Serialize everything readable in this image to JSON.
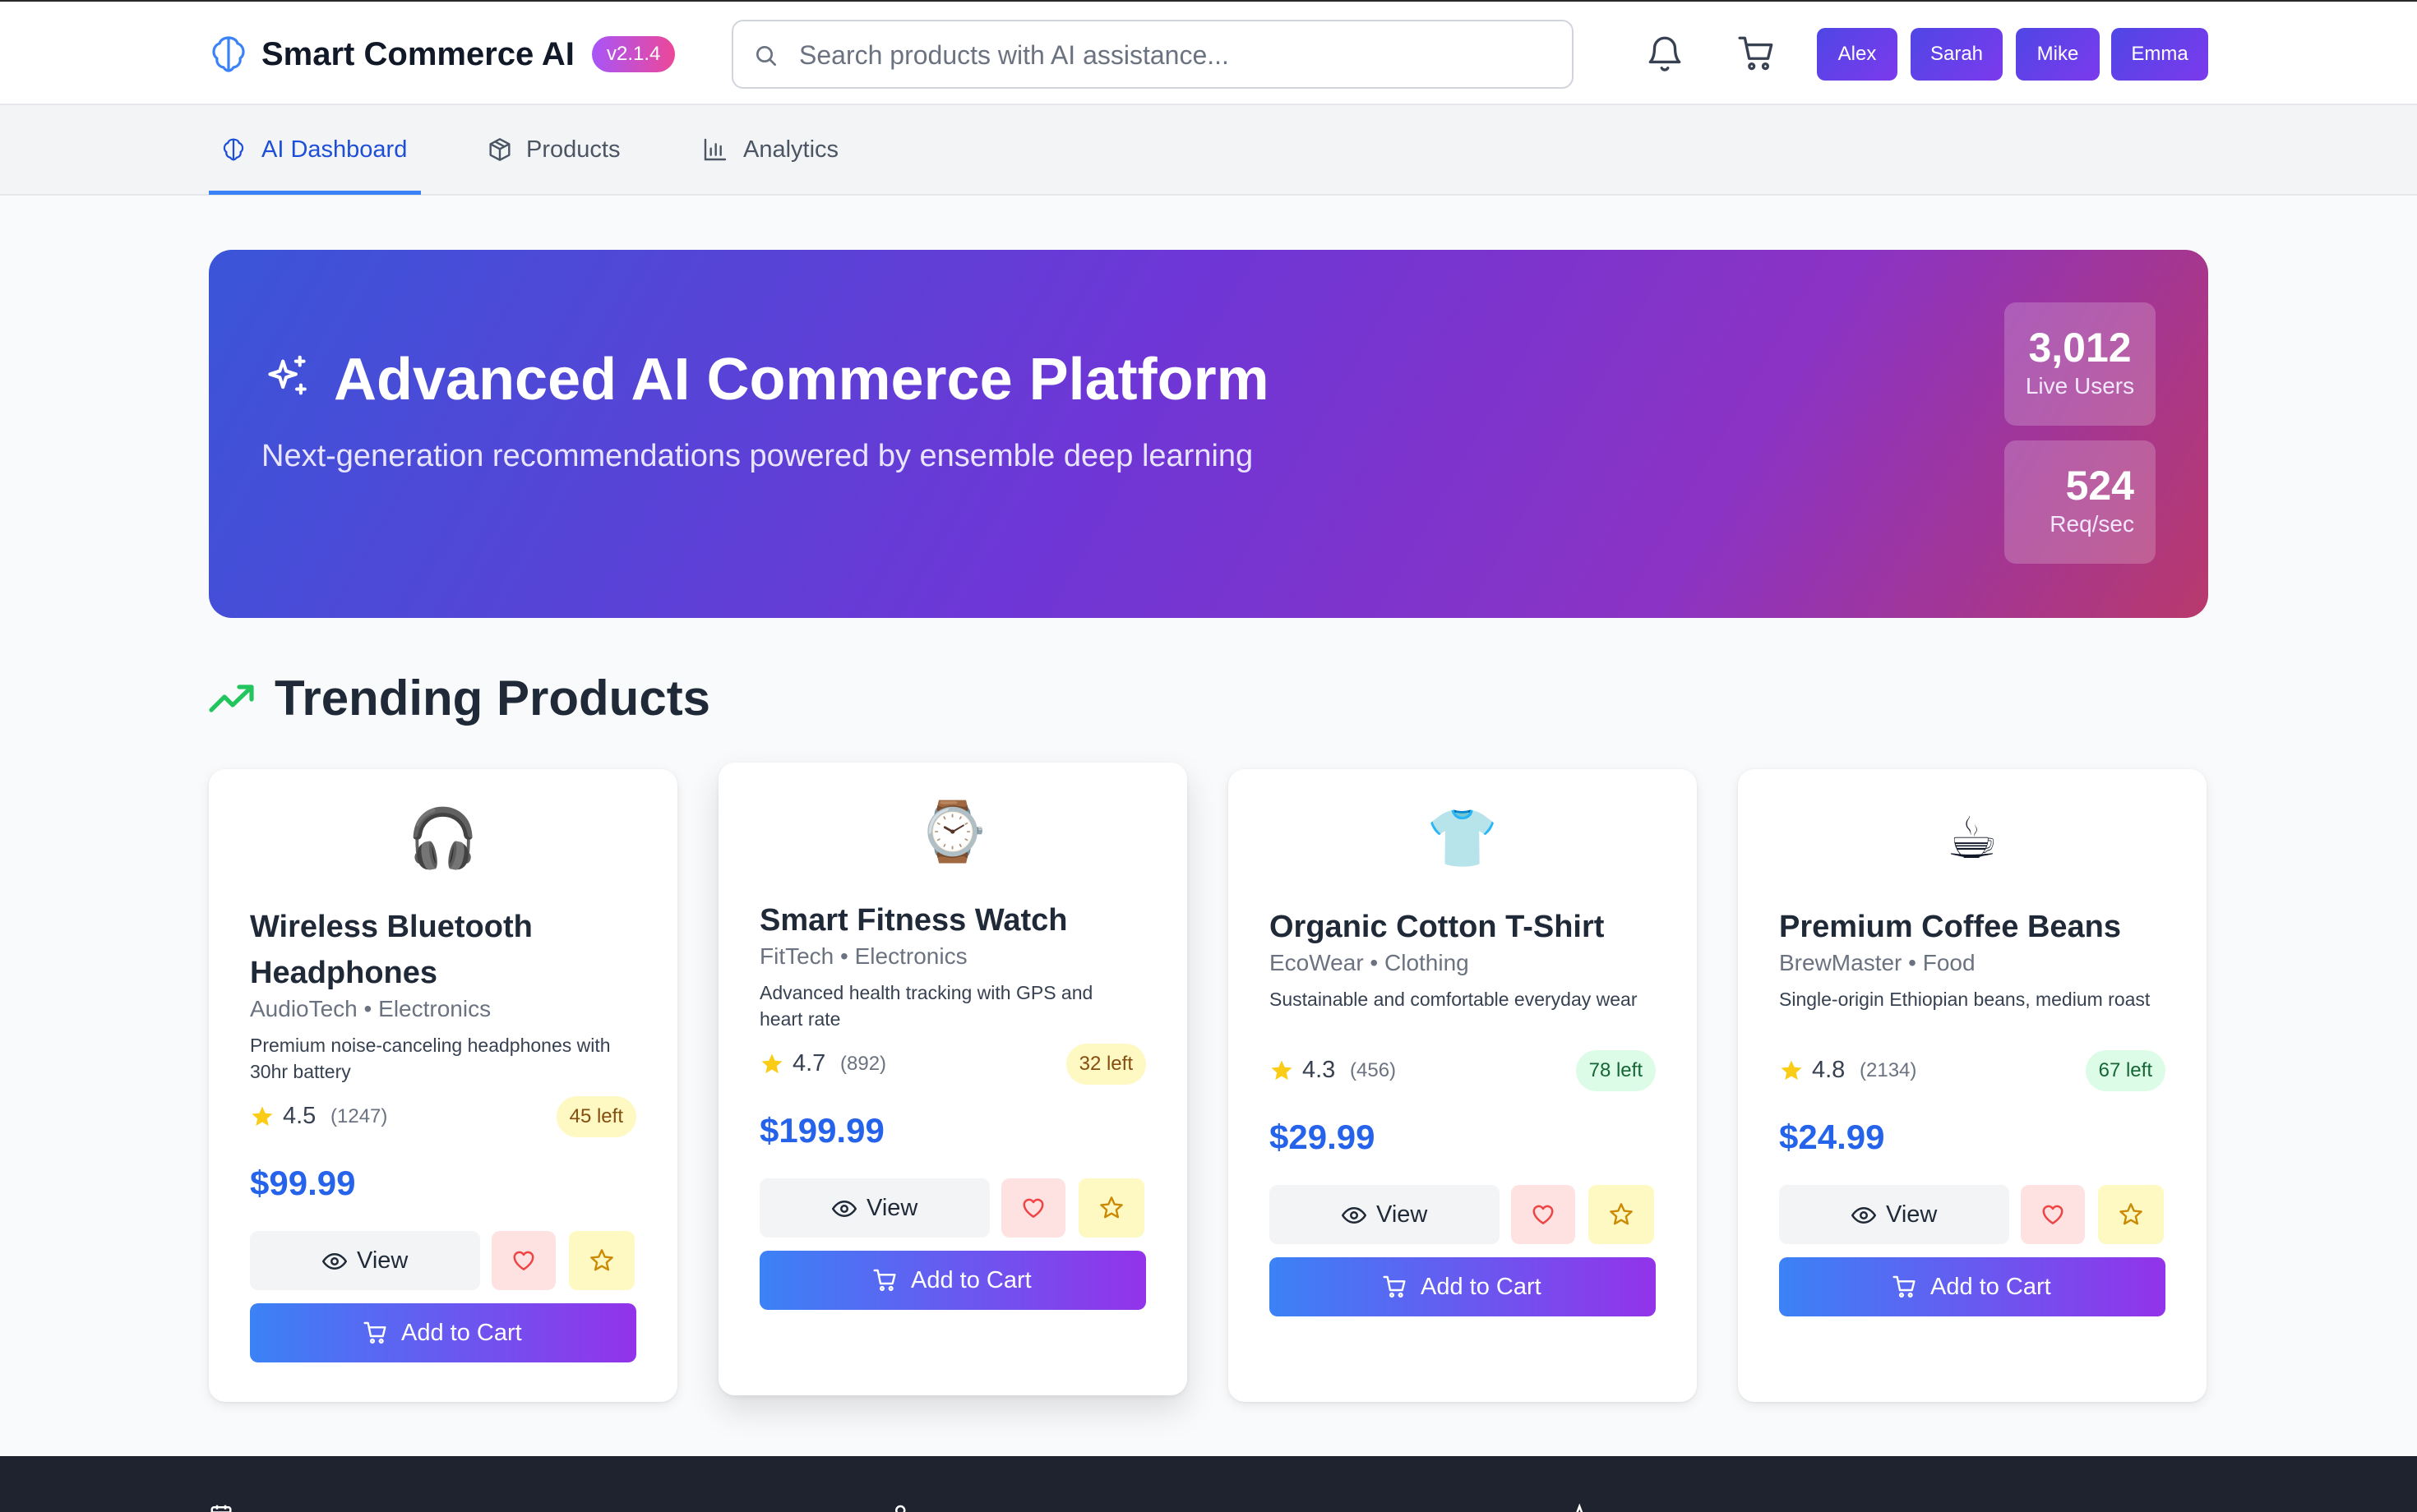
{
  "header": {
    "brand": "Smart Commerce AI",
    "version": "v2.1.4",
    "search_placeholder": "Search products with AI assistance...",
    "users": [
      "Alex",
      "Sarah",
      "Mike",
      "Emma"
    ]
  },
  "nav": {
    "tabs": [
      {
        "label": "AI Dashboard",
        "icon": "brain-icon",
        "active": true
      },
      {
        "label": "Products",
        "icon": "box-icon",
        "active": false
      },
      {
        "label": "Analytics",
        "icon": "bar-chart-icon",
        "active": false
      }
    ]
  },
  "hero": {
    "title": "Advanced AI Commerce Platform",
    "subtitle": "Next-generation recommendations powered by ensemble deep learning",
    "stats": [
      {
        "value": "3,012",
        "label": "Live Users"
      },
      {
        "value": "524",
        "label": "Req/sec"
      }
    ]
  },
  "trending": {
    "title": "Trending Products",
    "products": [
      {
        "emoji": "🎧",
        "name": "Wireless Bluetooth Headphones",
        "brand": "AudioTech",
        "category": "Electronics",
        "description": "Premium noise-canceling headphones with 30hr battery",
        "rating": "4.5",
        "reviews": "(1247)",
        "stock": "45 left",
        "price": "$99.99"
      },
      {
        "emoji": "⌚",
        "name": "Smart Fitness Watch",
        "brand": "FitTech",
        "category": "Electronics",
        "description": "Advanced health tracking with GPS and heart rate",
        "rating": "4.7",
        "reviews": "(892)",
        "stock": "32 left",
        "price": "$199.99"
      },
      {
        "emoji": "👕",
        "name": "Organic Cotton T-Shirt",
        "brand": "EcoWear",
        "category": "Clothing",
        "description": "Sustainable and comfortable everyday wear",
        "rating": "4.3",
        "reviews": "(456)",
        "stock": "78 left",
        "price": "$29.99"
      },
      {
        "emoji": "☕",
        "name": "Premium Coffee Beans",
        "brand": "BrewMaster",
        "category": "Food",
        "description": "Single-origin Ethiopian beans, medium roast",
        "rating": "4.8",
        "reviews": "(2134)",
        "stock": "67 left",
        "price": "$24.99"
      }
    ],
    "buttons": {
      "view": "View",
      "add_to_cart": "Add to Cart"
    }
  },
  "colors": {
    "accent": "#2563eb",
    "hero_start": "#3a55d8",
    "hero_end": "#b8396c",
    "cart_gradient_start": "#3b82f6",
    "cart_gradient_end": "#9333ea"
  }
}
